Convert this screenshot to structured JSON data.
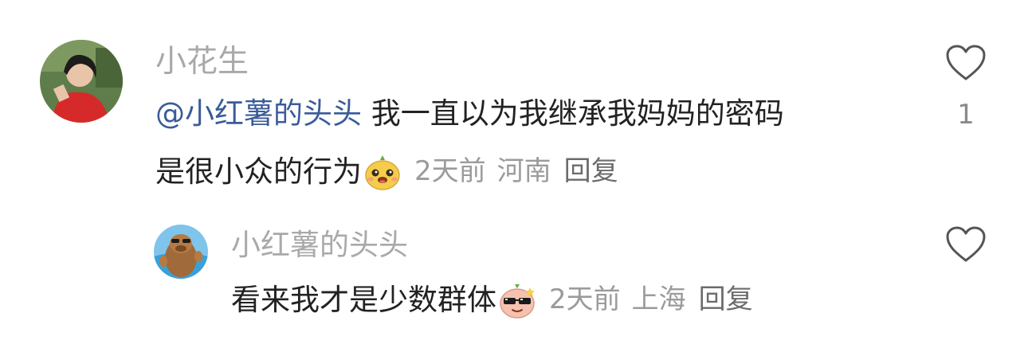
{
  "comment": {
    "username": "小花生",
    "mention": "@小红薯的头头",
    "text_line1": " 我一直以为我继承我妈妈的密码",
    "text_line2": "是很小众的行为",
    "emoji_icon": "smiling-bun-emoji-icon",
    "time": "2天前",
    "location": "河南",
    "reply_label": "回复",
    "like_count": "1"
  },
  "reply": {
    "username": "小红薯的头头",
    "text": "看来我才是少数群体",
    "emoji_icon": "sunglasses-bun-emoji-icon",
    "time": "2天前",
    "location": "上海",
    "reply_label": "回复"
  },
  "colors": {
    "username": "#a9a9a9",
    "mention": "#3a5b9a",
    "text": "#222222",
    "meta": "#9b9b9b",
    "reply_link": "#6b6b6b",
    "icon": "#555555"
  },
  "icons": {
    "like": "heart-outline-icon"
  }
}
